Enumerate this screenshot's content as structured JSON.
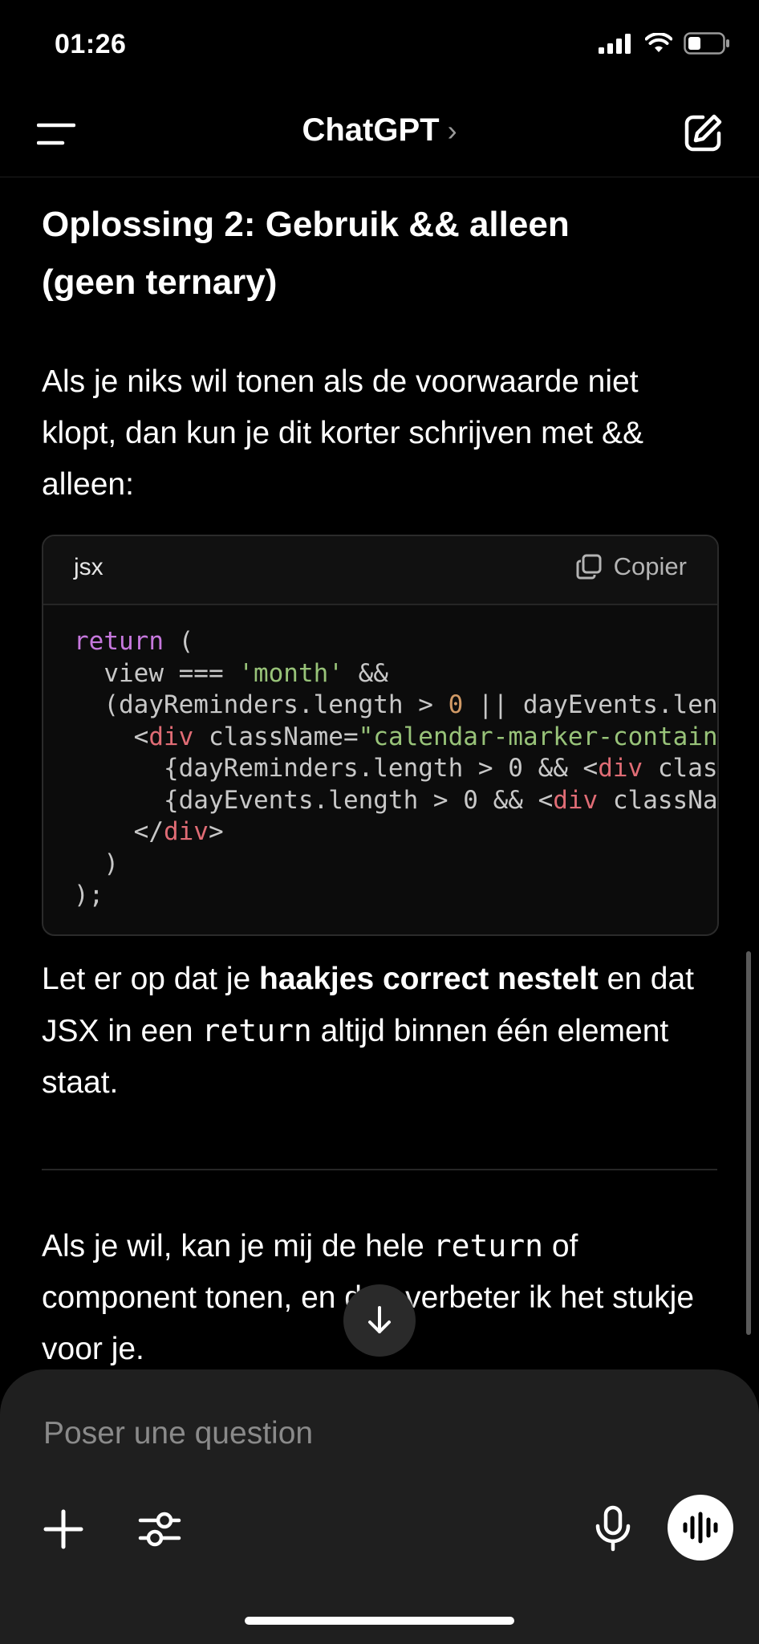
{
  "status_bar": {
    "time": "01:26"
  },
  "header": {
    "title": "ChatGPT",
    "chevron": "›"
  },
  "content": {
    "heading_line1": "Oplossing 2: Gebruik && alleen",
    "heading_line2": "(geen ternary)",
    "para1": "Als je niks wil tonen als de voorwaarde niet klopt, dan kun je dit korter schrijven met && alleen:",
    "code_block": {
      "language": "jsx",
      "copy_label": "Copier"
    },
    "para2": {
      "part1": "Let er op dat je ",
      "bold": "haakjes correct nestelt",
      "part2": " en dat JSX in een ",
      "code": "return",
      "part3": " altijd binnen één element staat."
    },
    "para3": {
      "part1": "Als je wil, kan je mij de hele ",
      "code": "return",
      "part2": " of component tonen, en dan verbeter ik het stukje voor je."
    }
  },
  "composer": {
    "placeholder": "Poser une question"
  },
  "icons": {
    "menu": "menu-icon",
    "compose": "compose-icon",
    "copy": "copy-icon",
    "scroll_down": "arrow-down-icon",
    "plus": "plus-icon",
    "tools": "sliders-icon",
    "mic": "microphone-icon",
    "voice": "voice-waveform-icon"
  },
  "colors": {
    "background": "#000000",
    "composer_bg": "#1f1f1f",
    "keyword": "#c678dd",
    "string": "#98c379",
    "number": "#d19a66",
    "tag": "#e06c75"
  }
}
